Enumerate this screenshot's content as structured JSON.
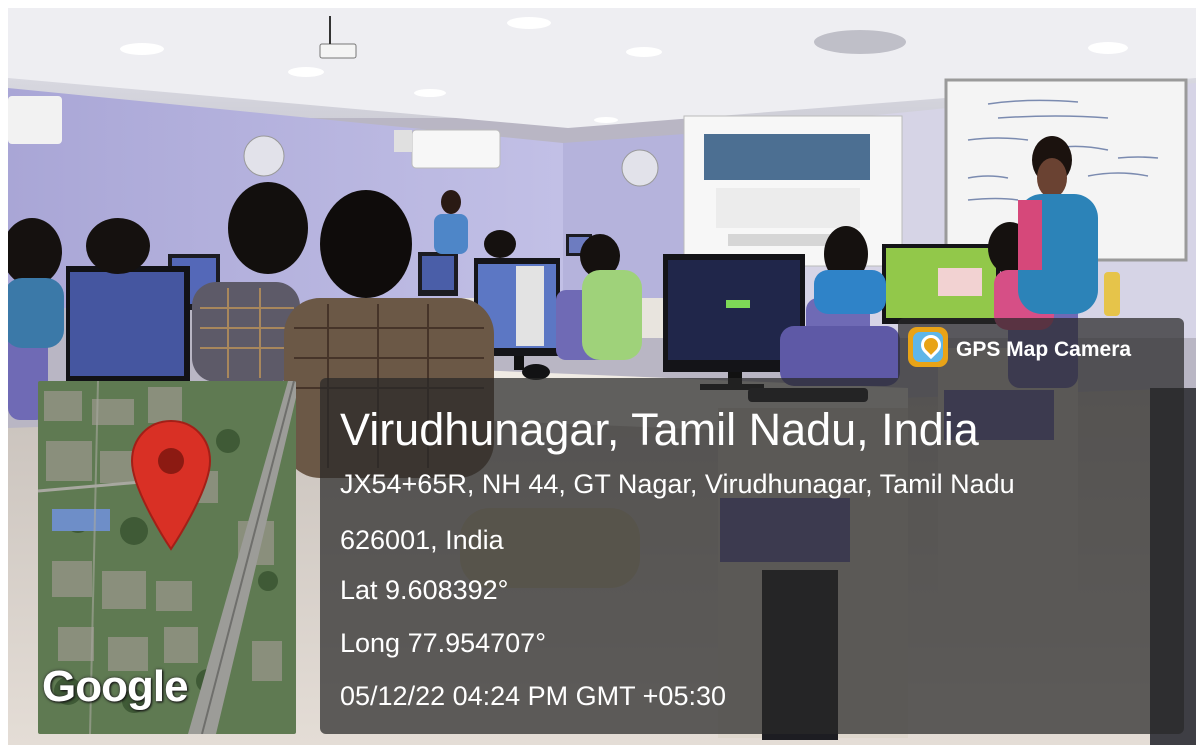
{
  "app": {
    "name": "GPS Map Camera",
    "icon": "map-pin-icon"
  },
  "location": {
    "title": "Virudhunagar, Tamil Nadu, India",
    "address_line1": "JX54+65R, NH 44, GT Nagar, Virudhunagar, Tamil Nadu",
    "address_line2": "626001, India",
    "latitude": "Lat 9.608392°",
    "longitude": "Long 77.954707°",
    "timestamp": "05/12/22 04:24 PM GMT +05:30"
  },
  "map": {
    "attribution": "Google",
    "pin_icon": "map-marker-icon",
    "pin_color": "#d93025"
  },
  "colors": {
    "overlay": "#282828",
    "text": "#ffffff",
    "wall": "#b3b3d8",
    "chair": "#6f6ab5"
  }
}
